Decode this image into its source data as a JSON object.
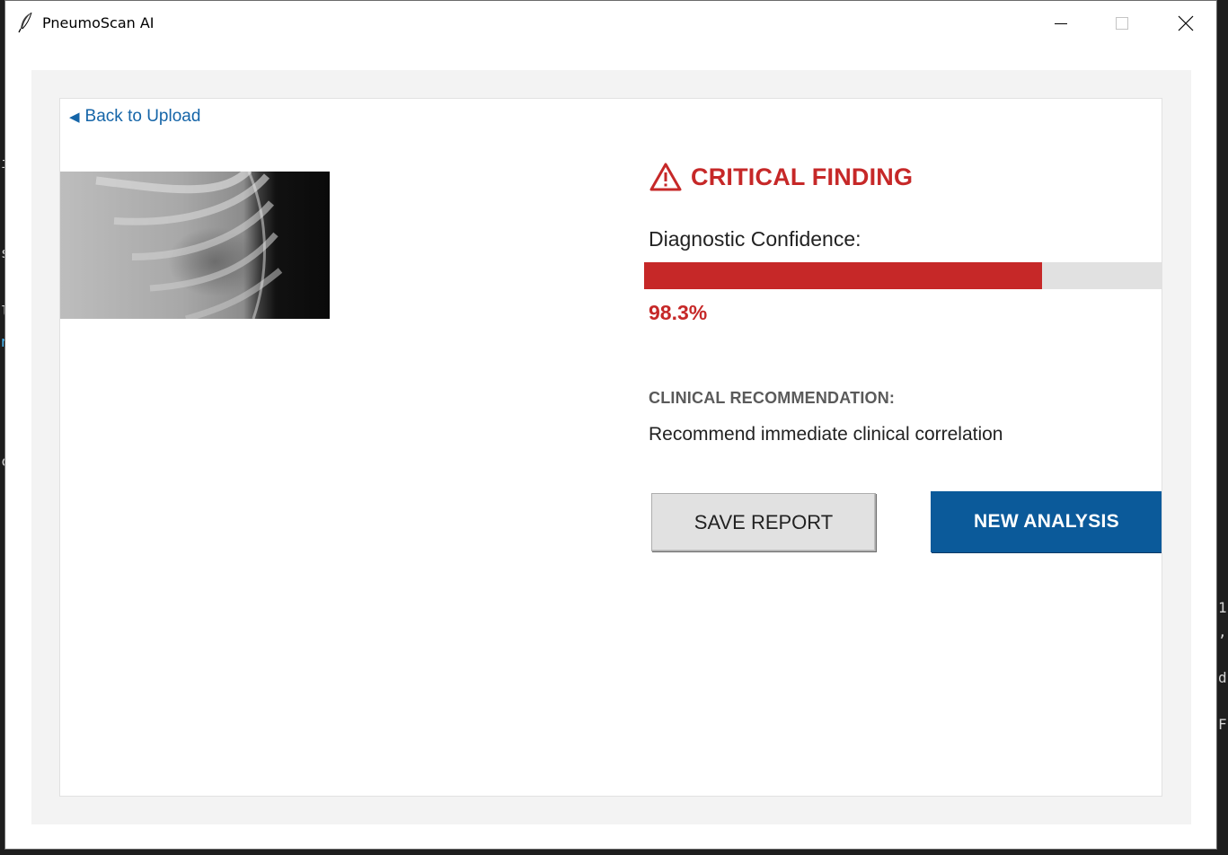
{
  "window": {
    "title": "PneumoScan AI",
    "controls": {
      "minimize_icon": "minimize-icon",
      "maximize_icon": "maximize-icon",
      "close_icon": "close-icon"
    }
  },
  "background_editor": {
    "left_glyphs": [
      "i",
      "s",
      "l",
      "n",
      "c"
    ],
    "right_glyphs": [
      "1",
      ",",
      "d",
      "F"
    ]
  },
  "nav": {
    "back_label": "Back to Upload",
    "back_icon": "left-triangle-icon"
  },
  "result": {
    "finding_icon": "warning-triangle-icon",
    "finding_title": "CRITICAL FINDING",
    "confidence_label": "Diagnostic Confidence:",
    "confidence_value": "98.3%",
    "confidence_fraction": 0.763,
    "recommendation_heading": "CLINICAL RECOMMENDATION:",
    "recommendation_text": "Recommend immediate clinical correlation"
  },
  "actions": {
    "save_label": "SAVE REPORT",
    "new_label": "NEW ANALYSIS"
  },
  "colors": {
    "critical": "#c62828",
    "primary": "#0b5a9a",
    "link": "#1565a8"
  }
}
